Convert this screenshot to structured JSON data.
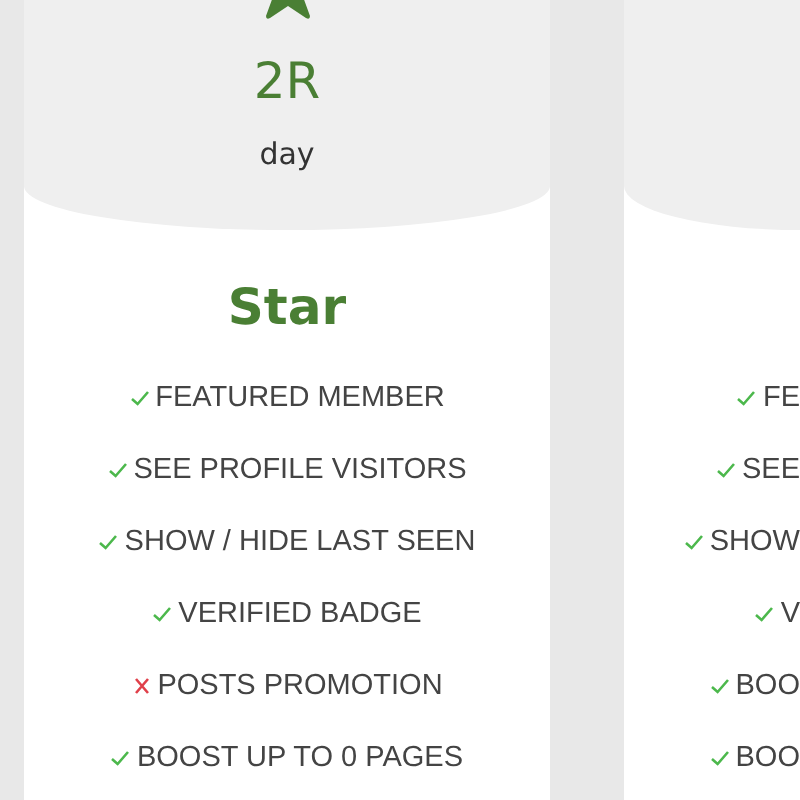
{
  "plans": [
    {
      "price": "2R",
      "period": "day",
      "name": "Star",
      "features": [
        {
          "text": "FEATURED MEMBER",
          "included": true
        },
        {
          "text": "SEE PROFILE VISITORS",
          "included": true
        },
        {
          "text": "SHOW / HIDE LAST SEEN",
          "included": true
        },
        {
          "text": "VERIFIED BADGE",
          "included": true
        },
        {
          "text": "POSTS PROMOTION",
          "included": false
        },
        {
          "text": "BOOST UP TO 0 PAGES",
          "included": true
        }
      ]
    },
    {
      "features": [
        {
          "text": "FE",
          "included": true
        },
        {
          "text": "SEE",
          "included": true
        },
        {
          "text": "SHOW",
          "included": true
        },
        {
          "text": "V",
          "included": true
        },
        {
          "text": "BOO",
          "included": true
        },
        {
          "text": "BOO",
          "included": true
        }
      ]
    }
  ]
}
